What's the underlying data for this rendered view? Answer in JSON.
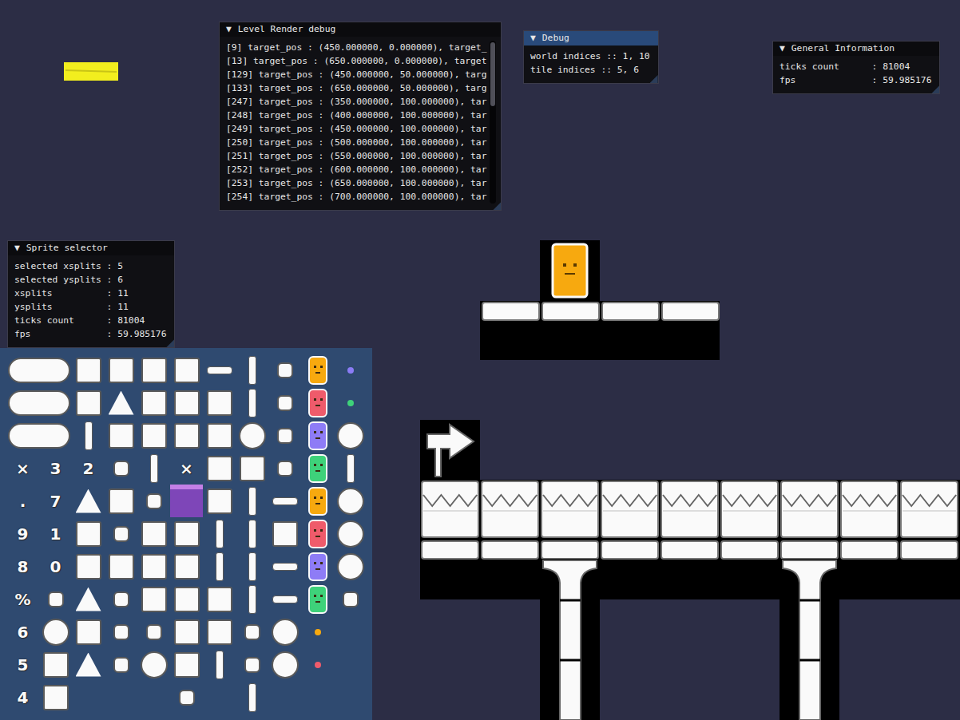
{
  "windows": [
    {
      "title": "Level Render debug",
      "collapse": "▼",
      "focused": false,
      "scrollbar": true,
      "lines": [
        "[9] target_pos : (450.000000, 0.000000), target_",
        "[13] target_pos : (650.000000, 0.000000), target",
        "[129] target_pos : (450.000000, 50.000000), targ",
        "[133] target_pos : (650.000000, 50.000000), targ",
        "[247] target_pos : (350.000000, 100.000000), tar",
        "[248] target_pos : (400.000000, 100.000000), tar",
        "[249] target_pos : (450.000000, 100.000000), tar",
        "[250] target_pos : (500.000000, 100.000000), tar",
        "[251] target_pos : (550.000000, 100.000000), tar",
        "[252] target_pos : (600.000000, 100.000000), tar",
        "[253] target_pos : (650.000000, 100.000000), tar",
        "[254] target_pos : (700.000000, 100.000000), tar"
      ]
    },
    {
      "title": "Debug",
      "collapse": "▼",
      "focused": true,
      "scrollbar": false,
      "lines": [
        "world indices :: 1, 10",
        "tile indices :: 5, 6"
      ]
    },
    {
      "title": "General Information",
      "collapse": "▼",
      "focused": false,
      "scrollbar": false,
      "lines": [
        "ticks count      : 81004",
        "fps              : 59.985176"
      ]
    },
    {
      "title": "Sprite selector",
      "collapse": "▼",
      "focused": false,
      "scrollbar": false,
      "lines": [
        "selected xsplits : 5",
        "selected ysplits : 6",
        "xsplits          : 11",
        "ysplits          : 11",
        "ticks count      : 81004",
        "fps              : 59.985176"
      ]
    }
  ],
  "sprite_sheet": {
    "cells": [
      [
        {
          "kind": "wide",
          "selected": false
        },
        {
          "kind": "empty",
          "selected": false
        },
        {
          "kind": "block",
          "selected": false
        },
        {
          "kind": "block",
          "selected": false
        },
        {
          "kind": "block",
          "selected": false
        },
        {
          "kind": "block",
          "selected": false
        },
        {
          "kind": "flat",
          "selected": false
        },
        {
          "kind": "slim",
          "selected": false
        },
        {
          "kind": "small",
          "selected": false
        },
        {
          "kind": "chara",
          "color": "#f7a90f",
          "selected": false
        },
        {
          "kind": "dot",
          "color": "#8b7cf6",
          "selected": false
        }
      ],
      [
        {
          "kind": "wide",
          "selected": false
        },
        {
          "kind": "empty",
          "selected": false
        },
        {
          "kind": "block",
          "selected": false
        },
        {
          "kind": "tri",
          "selected": false
        },
        {
          "kind": "block",
          "selected": false
        },
        {
          "kind": "block",
          "selected": false
        },
        {
          "kind": "block",
          "selected": false
        },
        {
          "kind": "slim",
          "selected": false
        },
        {
          "kind": "small",
          "selected": false
        },
        {
          "kind": "chara",
          "color": "#ef5b6b",
          "selected": false
        },
        {
          "kind": "dot",
          "color": "#3ed27a",
          "selected": false
        }
      ],
      [
        {
          "kind": "wide",
          "selected": false
        },
        {
          "kind": "empty",
          "selected": false
        },
        {
          "kind": "slim",
          "selected": false
        },
        {
          "kind": "block",
          "selected": false
        },
        {
          "kind": "block",
          "selected": false
        },
        {
          "kind": "block",
          "selected": false
        },
        {
          "kind": "block",
          "selected": false
        },
        {
          "kind": "round",
          "selected": false
        },
        {
          "kind": "small",
          "selected": false
        },
        {
          "kind": "chara",
          "color": "#8e7cf6",
          "selected": false
        },
        {
          "kind": "round",
          "selected": false
        }
      ],
      [
        {
          "kind": "glyph",
          "text": "×",
          "selected": false
        },
        {
          "kind": "glyph",
          "text": "3",
          "selected": false
        },
        {
          "kind": "glyph",
          "text": "2",
          "selected": false
        },
        {
          "kind": "small",
          "selected": false
        },
        {
          "kind": "slim",
          "selected": false
        },
        {
          "kind": "glyph",
          "text": "×",
          "selected": false
        },
        {
          "kind": "block",
          "selected": false
        },
        {
          "kind": "block",
          "selected": false
        },
        {
          "kind": "small",
          "selected": false
        },
        {
          "kind": "chara",
          "color": "#3ed27a",
          "selected": false
        },
        {
          "kind": "slim",
          "selected": false
        }
      ],
      [
        {
          "kind": "glyph",
          "text": ".",
          "selected": false
        },
        {
          "kind": "glyph",
          "text": "7",
          "selected": false
        },
        {
          "kind": "tri",
          "selected": false
        },
        {
          "kind": "block",
          "selected": false
        },
        {
          "kind": "small",
          "selected": false
        },
        {
          "kind": "empty",
          "selected": true
        },
        {
          "kind": "block",
          "selected": false
        },
        {
          "kind": "slim",
          "selected": false
        },
        {
          "kind": "flat",
          "selected": false
        },
        {
          "kind": "chara",
          "color": "#f7a90f",
          "selected": false
        },
        {
          "kind": "round",
          "selected": false
        }
      ],
      [
        {
          "kind": "glyph",
          "text": "9",
          "selected": false
        },
        {
          "kind": "glyph",
          "text": "1",
          "selected": false
        },
        {
          "kind": "block",
          "selected": false
        },
        {
          "kind": "small",
          "selected": false
        },
        {
          "kind": "block",
          "selected": false
        },
        {
          "kind": "block",
          "selected": false
        },
        {
          "kind": "slim",
          "selected": false
        },
        {
          "kind": "slim",
          "selected": false
        },
        {
          "kind": "block",
          "selected": false
        },
        {
          "kind": "chara",
          "color": "#ef5b6b",
          "selected": false
        },
        {
          "kind": "round",
          "selected": false
        }
      ],
      [
        {
          "kind": "glyph",
          "text": "8",
          "selected": false
        },
        {
          "kind": "glyph",
          "text": "0",
          "selected": false
        },
        {
          "kind": "block",
          "selected": false
        },
        {
          "kind": "block",
          "selected": false
        },
        {
          "kind": "block",
          "selected": false
        },
        {
          "kind": "block",
          "selected": false
        },
        {
          "kind": "slim",
          "selected": false
        },
        {
          "kind": "slim",
          "selected": false
        },
        {
          "kind": "flat",
          "selected": false
        },
        {
          "kind": "chara",
          "color": "#8e7cf6",
          "selected": false
        },
        {
          "kind": "round",
          "selected": false
        }
      ],
      [
        {
          "kind": "glyph",
          "text": "%",
          "selected": false
        },
        {
          "kind": "small",
          "selected": false
        },
        {
          "kind": "tri",
          "selected": false
        },
        {
          "kind": "small",
          "selected": false
        },
        {
          "kind": "block",
          "selected": false
        },
        {
          "kind": "block",
          "selected": false
        },
        {
          "kind": "block",
          "selected": false
        },
        {
          "kind": "slim",
          "selected": false
        },
        {
          "kind": "flat",
          "selected": false
        },
        {
          "kind": "chara",
          "color": "#3ed27a",
          "selected": false
        },
        {
          "kind": "small",
          "selected": false
        }
      ],
      [
        {
          "kind": "glyph",
          "text": "6",
          "selected": false
        },
        {
          "kind": "round",
          "selected": false
        },
        {
          "kind": "block",
          "selected": false
        },
        {
          "kind": "small",
          "selected": false
        },
        {
          "kind": "small",
          "selected": false
        },
        {
          "kind": "block",
          "selected": false
        },
        {
          "kind": "block",
          "selected": false
        },
        {
          "kind": "small",
          "selected": false
        },
        {
          "kind": "round",
          "selected": false
        },
        {
          "kind": "dot",
          "color": "#f7a90f",
          "selected": false
        },
        {
          "kind": "empty",
          "selected": false
        }
      ],
      [
        {
          "kind": "glyph",
          "text": "5",
          "selected": false
        },
        {
          "kind": "block",
          "selected": false
        },
        {
          "kind": "tri",
          "selected": false
        },
        {
          "kind": "small",
          "selected": false
        },
        {
          "kind": "round",
          "selected": false
        },
        {
          "kind": "block",
          "selected": false
        },
        {
          "kind": "slim",
          "selected": false
        },
        {
          "kind": "small",
          "selected": false
        },
        {
          "kind": "round",
          "selected": false
        },
        {
          "kind": "dot",
          "color": "#ef5b6b",
          "selected": false
        },
        {
          "kind": "empty",
          "selected": false
        }
      ],
      [
        {
          "kind": "glyph",
          "text": "4",
          "selected": false
        },
        {
          "kind": "block",
          "selected": false
        },
        {
          "kind": "empty",
          "selected": false
        },
        {
          "kind": "empty",
          "selected": false
        },
        {
          "kind": "empty",
          "selected": false
        },
        {
          "kind": "small",
          "selected": false
        },
        {
          "kind": "empty",
          "selected": false
        },
        {
          "kind": "slim",
          "selected": false
        },
        {
          "kind": "empty",
          "selected": false
        },
        {
          "kind": "empty",
          "selected": false
        },
        {
          "kind": "empty",
          "selected": false
        }
      ]
    ]
  }
}
